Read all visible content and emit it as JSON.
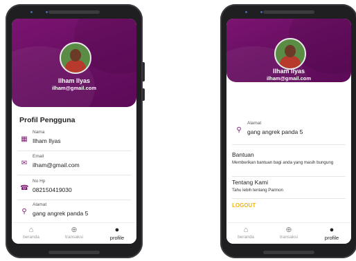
{
  "user": {
    "name": "Ilham Ilyas",
    "email": "ilham@gmail.com"
  },
  "profile_section": {
    "title": "Profil Pengguna",
    "fields": [
      {
        "label": "Nama",
        "value": "Ilham Ilyas",
        "icon": "id-badge-icon"
      },
      {
        "label": "Email",
        "value": "ilham@gmail.com",
        "icon": "mail-icon"
      },
      {
        "label": "No Hp",
        "value": "082150419030",
        "icon": "phone-icon"
      },
      {
        "label": "Alamat",
        "value": "gang angrek panda 5",
        "icon": "location-icon"
      }
    ]
  },
  "info": [
    {
      "title": "Bantuan",
      "desc": "Memberikan bantuan bagi anda yang masih bungung"
    },
    {
      "title": "Tentang Kami",
      "desc": "Tahu lebih tentang Parmon"
    }
  ],
  "logout_label": "LOGOUT",
  "nav": [
    {
      "label": "beranda",
      "icon": "home-icon"
    },
    {
      "label": "transaksi",
      "icon": "plus-circle-icon"
    },
    {
      "label": "profile",
      "icon": "person-icon"
    }
  ],
  "colors": {
    "header": "#6a0f63",
    "logout": "#f2b705",
    "icon": "#7a1570"
  }
}
